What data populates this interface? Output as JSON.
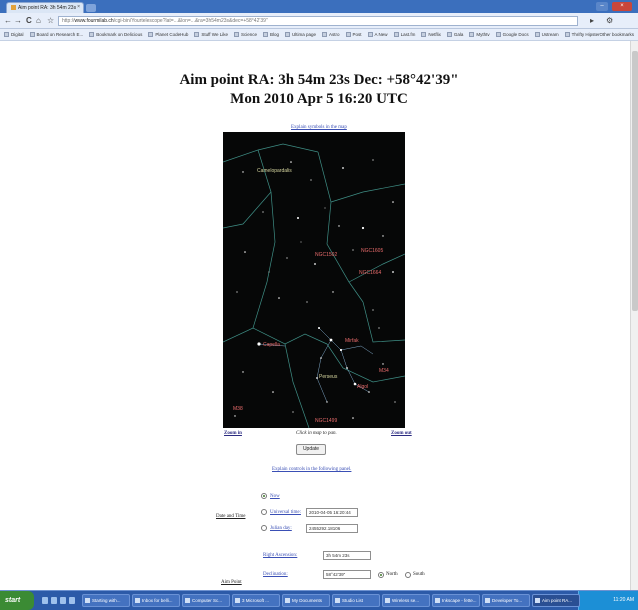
{
  "browser": {
    "tab_title": "Aim point RA: 3h 54m 23s",
    "tab_close": "×",
    "url_prefix": "http://",
    "url_host": "www.fourmilab.ch",
    "url_path": "/cgi-bin/Yourtelescope?lat=...&lon=...&ra=3h54m23s&dec=+58°42'39\"",
    "nav": {
      "back": "←",
      "forward": "→",
      "reload": "C",
      "home": "⌂",
      "star": "☆",
      "page": "▸",
      "tools": "⚙"
    },
    "bookmarks": [
      "Digital",
      "Board on Research E...",
      "Bookmark on Delicious",
      "Planet CodeHub",
      "Stuff We Like",
      "Science",
      "Blog",
      "Ultima page",
      "Astro",
      "Post",
      "A New",
      "Last.fm",
      "Netflix",
      "Gala",
      "Mythtv",
      "Google Docs",
      "Ustream",
      "Thrifty Hipster"
    ],
    "other_bookmarks": "Other bookmarks"
  },
  "page": {
    "title_line1": "Aim point RA: 3h 54m 23s Dec: +58°42'39\"",
    "title_line2": "Mon 2010 Apr 5 16:20 UTC",
    "explain_symbols": "Explain symbols in the map",
    "zoom_in": "Zoom in",
    "pan_note": "Click in map to pan.",
    "zoom_out": "Zoom out",
    "update_button": "Update",
    "explain_controls": "Explain controls in the following panel.",
    "date_and_time_label": "Date and Time",
    "now_label": "Now",
    "universal_time_label": "Universal time:",
    "universal_time_value": "2010-04-05 16:20:44",
    "julian_day_label": "Julian day:",
    "julian_day_value": "2455292.18106",
    "right_ascension_label": "Right Ascension:",
    "right_ascension_value": "3h 54m 23s",
    "declination_label": "Declination:",
    "declination_value": "58°42'39\"",
    "north_label": "North",
    "south_label": "South",
    "aim_point_label": "Aim Point"
  },
  "starmap": {
    "labels": [
      {
        "text": "Camelopardalis",
        "color": "#d7d7a0"
      },
      {
        "text": "Capella",
        "color": "#e86b6b"
      },
      {
        "text": "Perseus",
        "color": "#d7d7a0"
      },
      {
        "text": "NGC1502",
        "color": "#e86b6b"
      },
      {
        "text": "NGC1605",
        "color": "#e86b6b"
      },
      {
        "text": "NGC1664",
        "color": "#e86b6b"
      },
      {
        "text": "Mirfak",
        "color": "#e86b6b"
      },
      {
        "text": "Algol",
        "color": "#e86b6b"
      },
      {
        "text": "M34",
        "color": "#e86b6b"
      },
      {
        "text": "NGC1499",
        "color": "#e86b6b"
      },
      {
        "text": "M38",
        "color": "#e86b6b"
      }
    ]
  },
  "taskbar": {
    "start": "start",
    "tasks": [
      "Starting with...",
      "Inbox for belli...",
      "Computer Sc...",
      "3 Microsoft ...",
      "My Documents",
      "Studio List",
      "Wireless se...",
      "Inkscape - fette...",
      "Developer To...",
      "Aim point RA..."
    ],
    "clock": "11:20 AM"
  },
  "colors": {
    "accent_link": "#3a4fb5",
    "map_background": "#060707",
    "constellation_lines": "#3f8f86",
    "star_label_red": "#e86b6b",
    "constellation_name": "#d7d7a0",
    "taskbar": "#2c5aa8",
    "start_button": "#3b8b34"
  }
}
